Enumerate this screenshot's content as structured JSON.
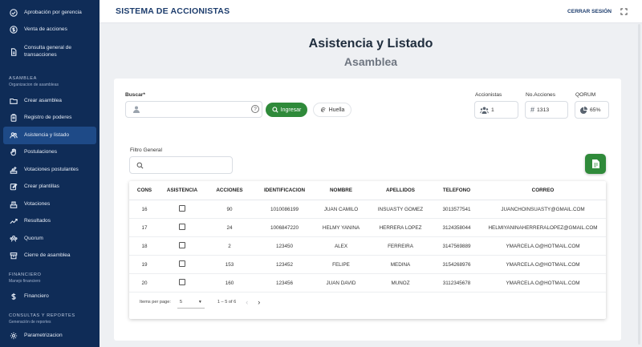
{
  "sidebar": {
    "top_items": [
      {
        "icon": "check-circle-icon",
        "label": "Aprobación por gerencia"
      },
      {
        "icon": "dollar-circle-icon",
        "label": "Venta de acciones"
      },
      {
        "icon": "document-icon",
        "label": "Consulta general de transacciones"
      }
    ],
    "asamblea": {
      "title": "ASAMBLEA",
      "subtitle": "Organizacion de asambleas",
      "items": [
        {
          "icon": "folder-icon",
          "label": "Crear asamblea"
        },
        {
          "icon": "clipboard-icon",
          "label": "Registro de poderes"
        },
        {
          "icon": "users-icon",
          "label": "Asistencia y listado",
          "active": true
        },
        {
          "icon": "hand-icon",
          "label": "Postulaciones"
        },
        {
          "icon": "vote-icon",
          "label": "Votaciones postulantes"
        },
        {
          "icon": "edit-icon",
          "label": "Crear plantillas"
        },
        {
          "icon": "ballot-icon",
          "label": "Votaciones"
        },
        {
          "icon": "chart-line-icon",
          "label": "Resultados"
        },
        {
          "icon": "group-icon",
          "label": "Quorum"
        },
        {
          "icon": "archive-icon",
          "label": "Cierre de asamblea"
        }
      ]
    },
    "financiero": {
      "title": "FINANCIERO",
      "subtitle": "Manejo financiero",
      "items": [
        {
          "icon": "dollar-icon",
          "label": "Financiero"
        }
      ]
    },
    "consultas": {
      "title": "CONSULTAS Y REPORTES",
      "subtitle": "Generación de reportes",
      "items": [
        {
          "icon": "settings-icon",
          "label": "Parametrizacion"
        }
      ]
    }
  },
  "header": {
    "title": "SISTEMA DE ACCIONISTAS",
    "logout": "CERRAR SESIÓN"
  },
  "page": {
    "title": "Asistencia y Listado",
    "subtitle": "Asamblea"
  },
  "search": {
    "label": "Buscar*",
    "value": "",
    "help": "?",
    "ingresar": "Ingresar",
    "huella": "Huella"
  },
  "stats": {
    "accionistas_label": "Accionistas",
    "accionistas_value": "1",
    "acciones_label": "No.Acciones",
    "acciones_value": "1313",
    "qorum_label": "QORUM",
    "qorum_value": "65%"
  },
  "filter": {
    "label": "Filtro General",
    "value": ""
  },
  "table": {
    "headers": [
      "CONS",
      "ASISTENCIA",
      "ACCIONES",
      "IDENTIFICACIÓN",
      "NOMBRE",
      "APELLIDOS",
      "TELEFONO",
      "CORREO"
    ],
    "rows": [
      {
        "cons": "16",
        "acciones": "90",
        "id": "1010086199",
        "nombre": "JUAN CAMILO",
        "apellidos": "INSUASTY GOMEZ",
        "telefono": "3013577541",
        "correo": "JUANCHOINSUASTY@GMAIL.COM"
      },
      {
        "cons": "17",
        "acciones": "24",
        "id": "1006847220",
        "nombre": "HELMY YANINA",
        "apellidos": "HERRERA LOPEZ",
        "telefono": "3124358044",
        "correo": "HELMIYANINAHERRERALOPEZ@GMAIL.COM"
      },
      {
        "cons": "18",
        "acciones": "2",
        "id": "123450",
        "nombre": "ALEX",
        "apellidos": "FERREIRA",
        "telefono": "3147569889",
        "correo": "YMARCELA.O@HOTMAIL.COM"
      },
      {
        "cons": "19",
        "acciones": "153",
        "id": "123452",
        "nombre": "FELIPE",
        "apellidos": "MEDINA",
        "telefono": "3154268976",
        "correo": "YMARCELA.O@HOTMAIL.COM"
      },
      {
        "cons": "20",
        "acciones": "160",
        "id": "123456",
        "nombre": "JUAN DAVID",
        "apellidos": "MUÑOZ",
        "telefono": "3112345678",
        "correo": "YMARCELA.O@HOTMAIL.COM"
      }
    ]
  },
  "pager": {
    "items_label": "Items per page:",
    "page_size": "5",
    "range": "1 – 5 of 6"
  },
  "colors": {
    "sidebar": "#0f2c57",
    "active": "#1e4a87",
    "accent_green": "#2f8a3a"
  }
}
